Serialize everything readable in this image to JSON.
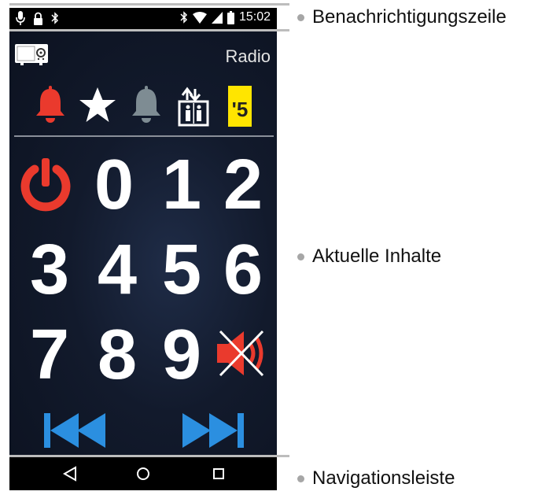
{
  "status_bar": {
    "left_icons": [
      "microphone-icon",
      "lock-icon",
      "bluetooth-icon"
    ],
    "right_icons": [
      "bluetooth-icon",
      "wifi-icon",
      "signal-icon",
      "battery-icon"
    ],
    "time": "15:02"
  },
  "app": {
    "title": "Radio",
    "header_icon": "radio-icon",
    "quick_icons": [
      "alarm-bell-icon",
      "favorite-star-icon",
      "bell-icon",
      "elevator-icon",
      "channel-5-icon"
    ],
    "channel_badge": "'5",
    "keypad": {
      "rows": [
        [
          "power",
          "0",
          "1",
          "2"
        ],
        [
          "3",
          "4",
          "5",
          "6"
        ],
        [
          "7",
          "8",
          "9",
          "mute"
        ]
      ]
    },
    "media_controls": [
      "previous-icon",
      "next-icon"
    ]
  },
  "nav_bar": {
    "buttons": [
      "back-icon",
      "home-icon",
      "recents-icon"
    ]
  },
  "callouts": {
    "notification_bar": "Benachrichtigungszeile",
    "current_content": "Aktuelle Inhalte",
    "navigation_bar": "Navigationsleiste"
  },
  "colors": {
    "red": "#ea3a2d",
    "blue": "#2b8fe0",
    "yellow": "#ffe500",
    "gray_bell": "#7e8c93"
  }
}
